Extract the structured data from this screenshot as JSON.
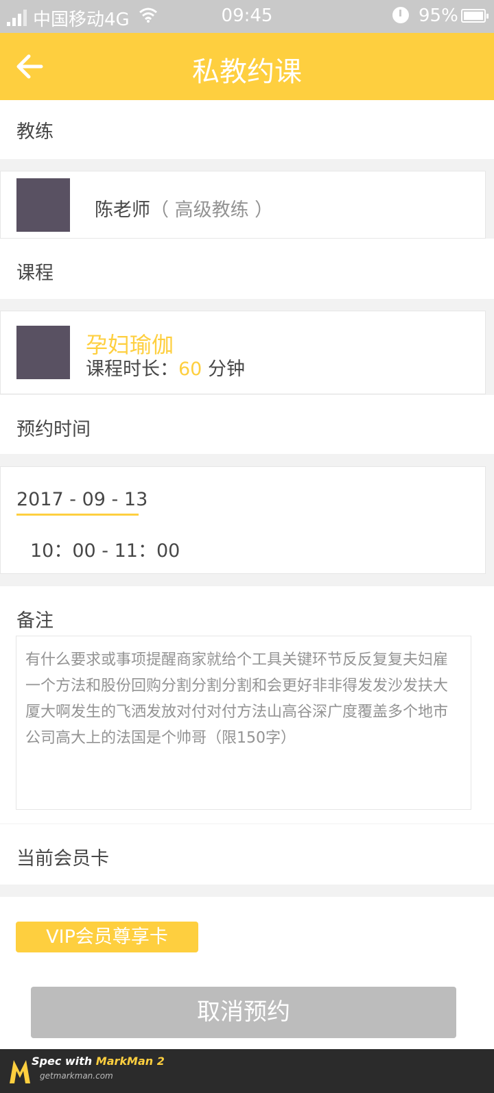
{
  "status": {
    "carrier": "中国移动4G",
    "time": "09:45",
    "battery": "95%"
  },
  "header": {
    "title": "私教约课",
    "back_icon": "arrow-left-icon"
  },
  "coach": {
    "section_label": "教练",
    "name": "陈老师",
    "level": "（ 高级教练 ）"
  },
  "course": {
    "section_label": "课程",
    "name": "孕妇瑜伽",
    "duration_prefix": "课程时长：",
    "duration_value": "60",
    "duration_unit": " 分钟"
  },
  "appointment": {
    "section_label": "预约时间",
    "date": "2017 - 09 - 13",
    "time_range": "10：00 - 11：00"
  },
  "note": {
    "section_label": "备注",
    "placeholder": "有什么要求或事项提醒商家就给个工具关键环节反反复复夫妇雇一个方法和股份回购分割分割分割和会更好非非得发发沙发扶大厦大啊发生的飞洒发放对付对付方法山高谷深广度覆盖多个地市公司高大上的法国是个帅哥（限150字）"
  },
  "membership": {
    "section_label": "当前会员卡",
    "card_label": "VIP会员尊享卡"
  },
  "actions": {
    "cancel_label": "取消预约"
  },
  "footer": {
    "brand_prefix": "Spec with ",
    "brand_name": "MarkMan 2",
    "site": "getmarkman.com"
  },
  "colors": {
    "accent": "#fecf3f",
    "title_text": "#ffffff",
    "body_text": "#474747",
    "secondary_text": "#939393",
    "cancel_button": "#bcbcbc"
  }
}
